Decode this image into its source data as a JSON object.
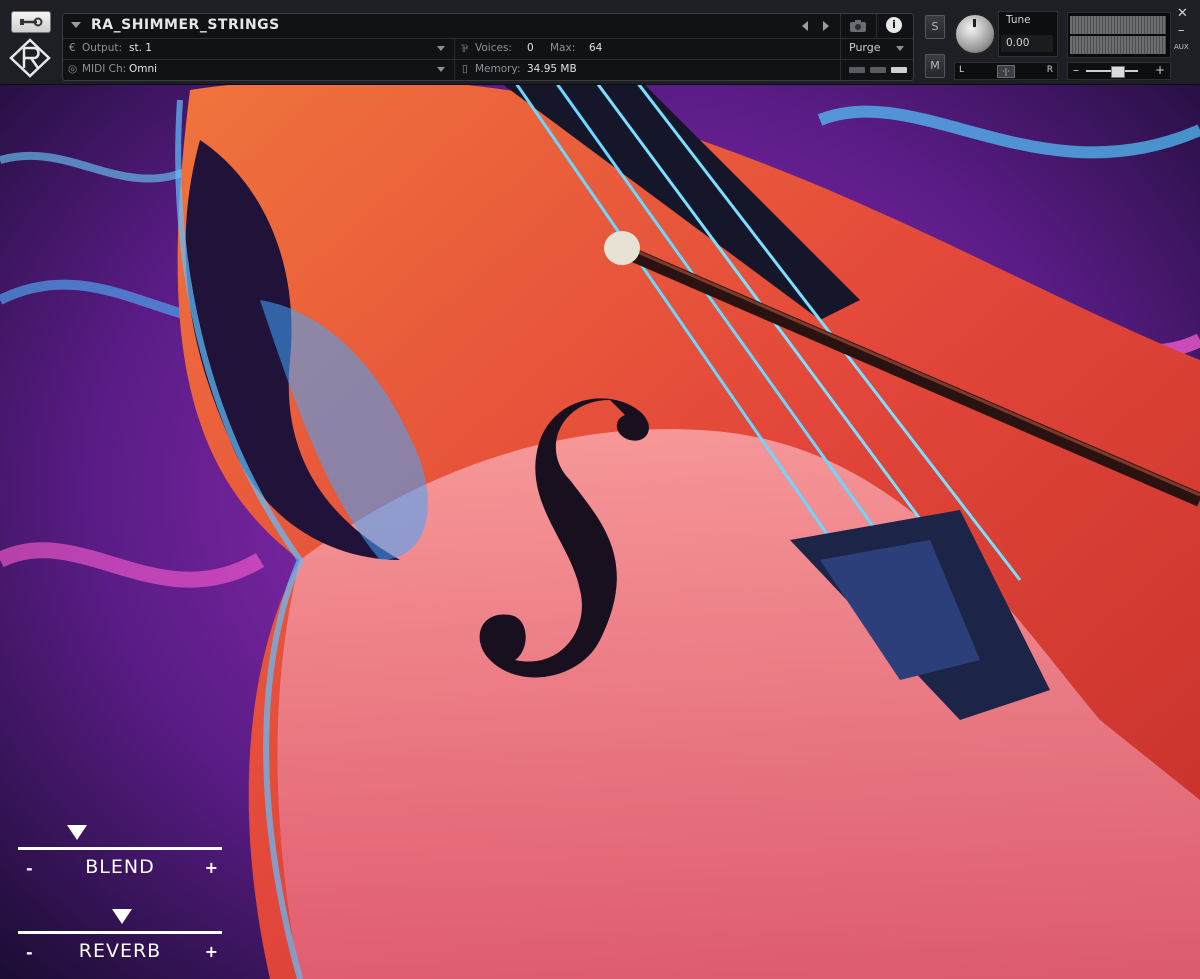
{
  "header": {
    "instrument_title": "RA_SHIMMER_STRINGS",
    "output_label": "Output:",
    "output_value": "st. 1",
    "midi_label": "MIDI Ch:",
    "midi_value": "Omni",
    "voices_label": "Voices:",
    "voices_value": "0",
    "max_label": "Max:",
    "max_value": "64",
    "memory_label": "Memory:",
    "memory_value": "34.95 MB",
    "purge_label": "Purge",
    "info_label": "i",
    "solo_label": "S",
    "mute_label": "M",
    "tune_label": "Tune",
    "tune_value": "0.00",
    "pan_left": "L",
    "pan_right": "R",
    "pan_center": "·|·",
    "vol_minus": "–",
    "vol_plus": "+",
    "aux_label": "AUX",
    "close_glyph": "✕",
    "minimize_glyph": "–"
  },
  "controls": {
    "blend": {
      "name": "BLEND",
      "minus": "-",
      "plus": "+",
      "level": 0.29
    },
    "reverb": {
      "name": "REVERB",
      "minus": "-",
      "plus": "+",
      "level": 0.51
    }
  },
  "icons": [
    "wrench-icon",
    "logo-icon",
    "camera-icon",
    "info-icon",
    "output-icon",
    "midi-icon",
    "voices-icon",
    "memory-icon"
  ]
}
